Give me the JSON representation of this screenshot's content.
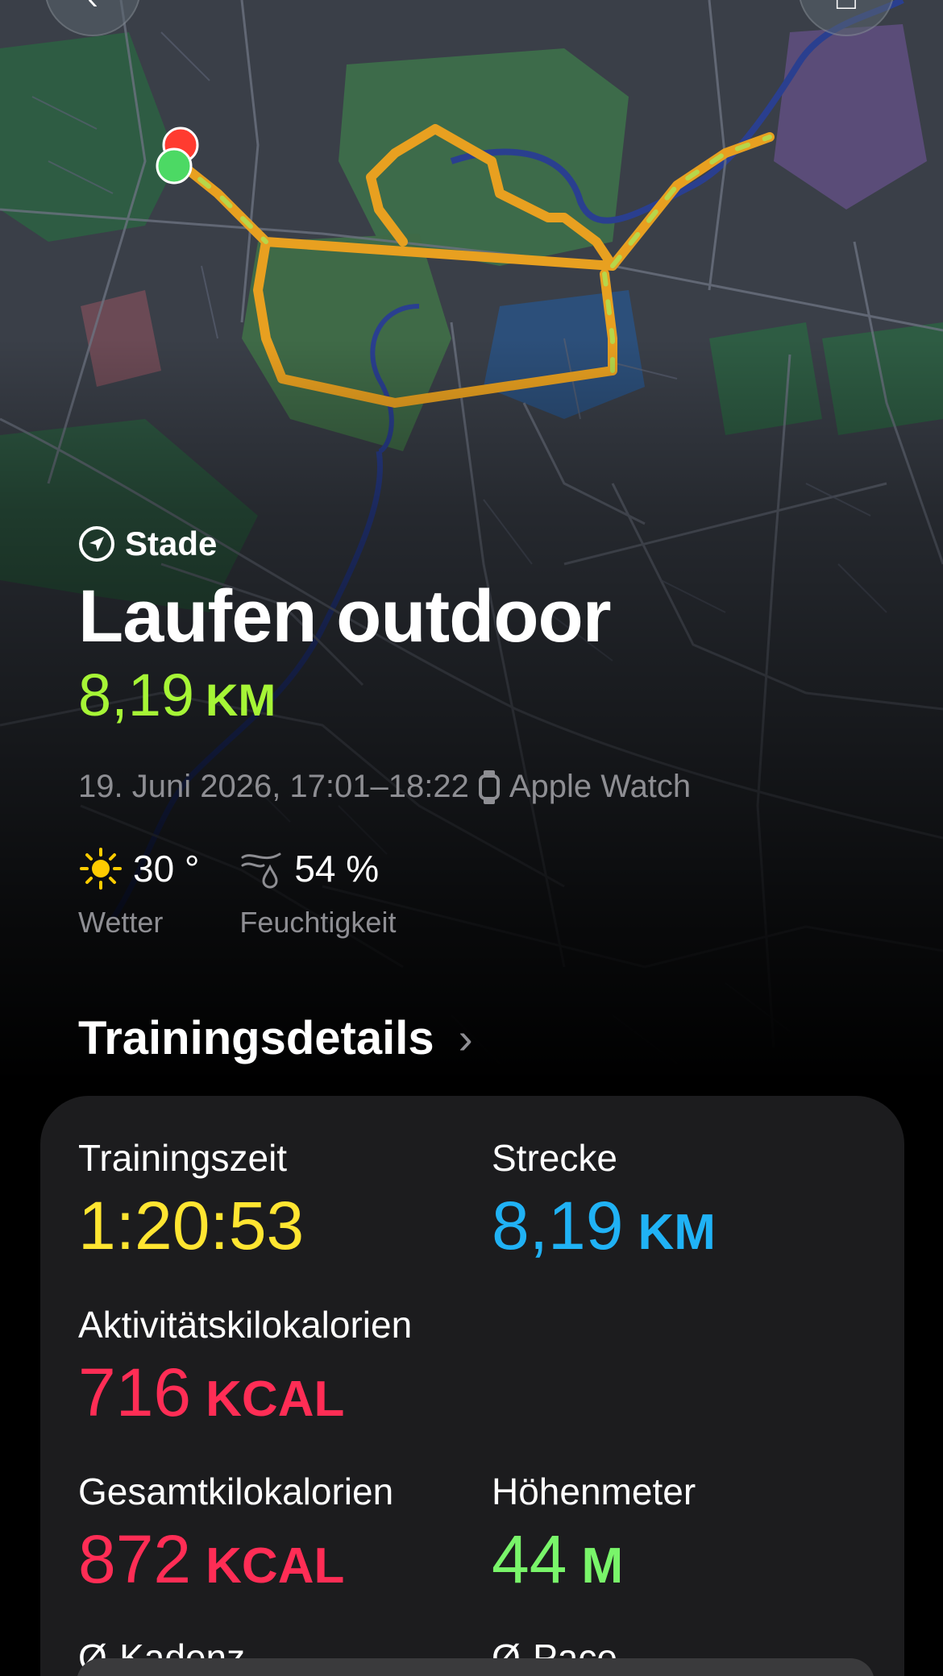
{
  "nav": {
    "back_glyph": "‹",
    "share_glyph": "□"
  },
  "workout": {
    "location": "Stade",
    "title": "Laufen outdoor",
    "distance_value": "8,19",
    "distance_unit": "KM",
    "datetime": "19. Juni 2026, 17:01–18:22",
    "device": "Apple Watch"
  },
  "weather": {
    "temperature": "30 °",
    "temperature_label": "Wetter",
    "humidity": "54 %",
    "humidity_label": "Feuchtigkeit"
  },
  "details": {
    "section_title": "Trainingsdetails",
    "chevron": "›",
    "metrics": [
      {
        "label": "Trainingszeit",
        "value": "1:20:53",
        "unit": ""
      },
      {
        "label": "Strecke",
        "value": "8,19",
        "unit": "KM"
      },
      {
        "label": "Aktivitätskilokalorien",
        "value": "716",
        "unit": "KCAL"
      },
      {
        "label": "Gesamtkilokalorien",
        "value": "872",
        "unit": "KCAL"
      },
      {
        "label": "Höhenmeter",
        "value": "44",
        "unit": "M"
      },
      {
        "label": "Ø-Kadenz",
        "value": "",
        "unit": ""
      },
      {
        "label": "Ø-Pace",
        "value": "",
        "unit": ""
      }
    ]
  },
  "colors": {
    "distance": "#a6f536",
    "time": "#ffe531",
    "strecke": "#20b2f5",
    "kcal": "#ff2d55",
    "elevation": "#79f56a"
  }
}
